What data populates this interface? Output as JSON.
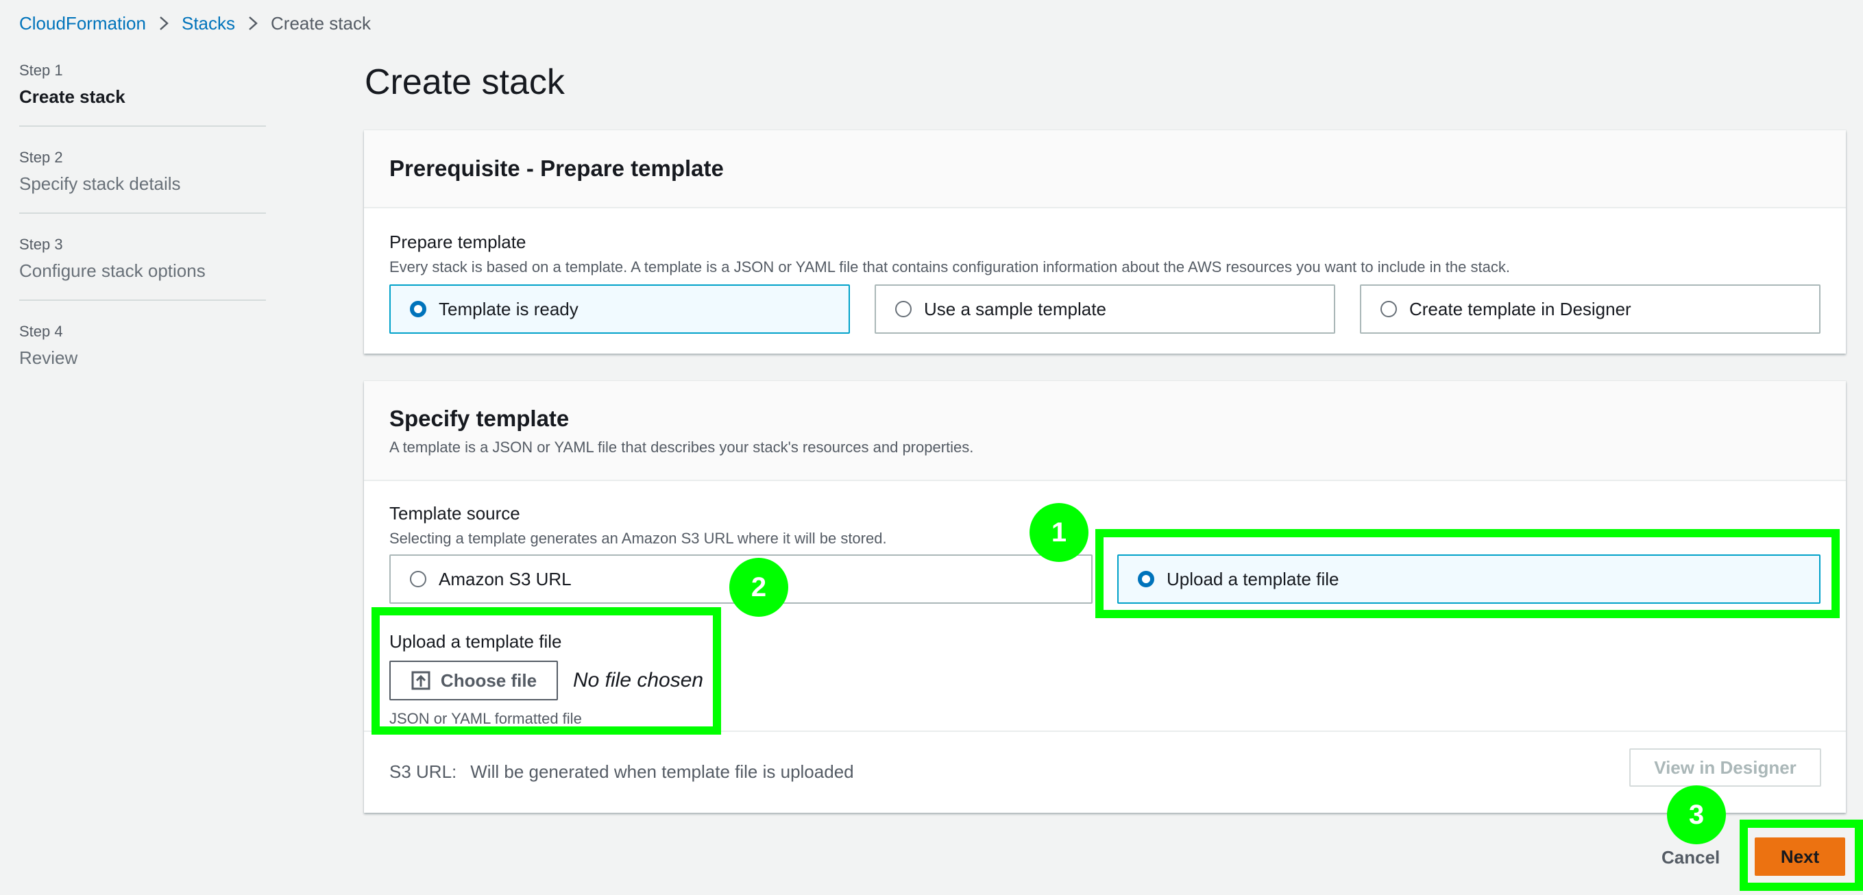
{
  "breadcrumb": {
    "items": [
      "CloudFormation",
      "Stacks",
      "Create stack"
    ]
  },
  "steps": [
    {
      "num": "Step 1",
      "title": "Create stack"
    },
    {
      "num": "Step 2",
      "title": "Specify stack details"
    },
    {
      "num": "Step 3",
      "title": "Configure stack options"
    },
    {
      "num": "Step 4",
      "title": "Review"
    }
  ],
  "page_title": "Create stack",
  "prereq": {
    "title": "Prerequisite - Prepare template",
    "label": "Prepare template",
    "desc": "Every stack is based on a template. A template is a JSON or YAML file that contains configuration information about the AWS resources you want to include in the stack.",
    "options": [
      "Template is ready",
      "Use a sample template",
      "Create template in Designer"
    ],
    "selected": "Template is ready"
  },
  "specify": {
    "title": "Specify template",
    "desc": "A template is a JSON or YAML file that describes your stack's resources and properties.",
    "source_label": "Template source",
    "source_desc": "Selecting a template generates an Amazon S3 URL where it will be stored.",
    "options": [
      "Amazon S3 URL",
      "Upload a template file"
    ],
    "selected": "Upload a template file",
    "upload_label": "Upload a template file",
    "choose_file": "Choose file",
    "no_file": "No file chosen",
    "upload_hint": "JSON or YAML formatted file",
    "s3_label": "S3 URL:",
    "s3_value": "Will be generated when template file is uploaded",
    "view_designer": "View in Designer"
  },
  "actions": {
    "cancel": "Cancel",
    "next": "Next"
  },
  "callouts": [
    "1",
    "2",
    "3"
  ],
  "colors": {
    "highlight": "#00ff00",
    "primary": "#ec7211",
    "link": "#0073bb",
    "selected_border": "#00a1c9"
  }
}
